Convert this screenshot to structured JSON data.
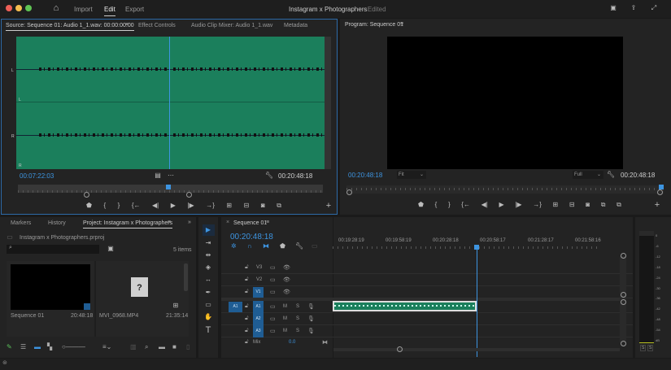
{
  "titlebar": {
    "nav": [
      "Import",
      "Edit",
      "Export"
    ],
    "active": "Edit",
    "title": "Instagram x Photographers",
    "status": "- Edited"
  },
  "source": {
    "tabs": [
      "Source: Sequence 01: Audio 1_1.wav: 00:00:00:00",
      "Effect Controls",
      "Audio Clip Mixer: Audio 1_1.wav",
      "Metadata"
    ],
    "channel_labels": [
      "L",
      "L",
      "R",
      "R"
    ],
    "current_time": "00:07:22:03",
    "duration": "00:20:48:18",
    "playhead_fraction": 0.49
  },
  "program": {
    "tab": "Program: Sequence 01",
    "current_time": "00:20:48:18",
    "zoom": "Fit",
    "resolution": "Full",
    "duration": "00:20:48:18"
  },
  "project": {
    "tabs": [
      "Markers",
      "History",
      "Project: Instagram x Photographers"
    ],
    "file": "Instagram x Photographers.prproj",
    "search_placeholder": "",
    "items_count": "5 items",
    "items": [
      {
        "name": "Sequence 01",
        "duration": "20:48:18"
      },
      {
        "name": "MVI_0968.MP4",
        "duration": "21:35:14"
      }
    ]
  },
  "timeline": {
    "tab": "Sequence 01",
    "current_time": "00:20:48:18",
    "ruler": [
      "00:19:28:19",
      "00:19:58:19",
      "00:20:28:18",
      "00:20:58:17",
      "00:21:28:17",
      "00:21:58:16"
    ],
    "video_tracks": [
      "V3",
      "V2",
      "V1"
    ],
    "audio_tracks": [
      "A1",
      "A2",
      "A3"
    ],
    "source_patch": "A1",
    "mix_label": "Mix",
    "mix_value": "0.0",
    "m": "M",
    "s": "S"
  },
  "meters": {
    "scale": [
      "0",
      "-6",
      "-12",
      "-18",
      "-24",
      "-30",
      "-36",
      "-42",
      "-48",
      "-54",
      "dB"
    ],
    "solo": [
      "S",
      "S"
    ]
  },
  "colors": {
    "accent": "#3d94e0",
    "waveform": "#1b7f5c"
  }
}
